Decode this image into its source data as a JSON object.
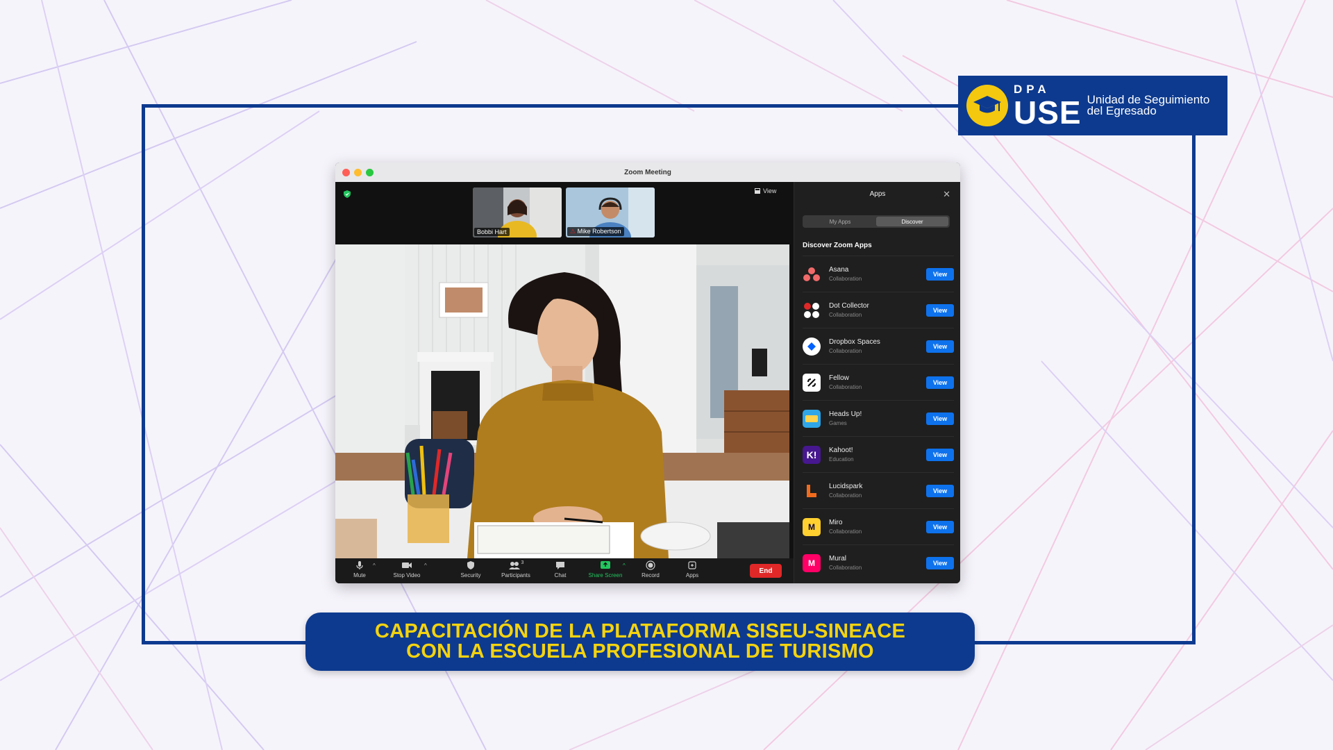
{
  "logo": {
    "dpa": "DPA",
    "use": "USE",
    "line1": "Unidad de Seguimiento",
    "line2": "del Egresado"
  },
  "window": {
    "title": "Zoom Meeting"
  },
  "meeting": {
    "view_label": "View",
    "participants": [
      {
        "name": "Bobbi Hart"
      },
      {
        "name": "Mike Robertson"
      }
    ]
  },
  "toolbar": {
    "mute": "Mute",
    "stop_video": "Stop Video",
    "security": "Security",
    "participants": "Participants",
    "participants_count": "3",
    "chat": "Chat",
    "share_screen": "Share Screen",
    "record": "Record",
    "apps": "Apps",
    "end": "End"
  },
  "apps_panel": {
    "title": "Apps",
    "tabs": [
      "My Apps",
      "Discover"
    ],
    "active_tab": "Discover",
    "heading": "Discover Zoom Apps",
    "view_label": "View",
    "items": [
      {
        "name": "Asana",
        "category": "Collaboration",
        "icon": "asana-icon"
      },
      {
        "name": "Dot Collector",
        "category": "Collaboration",
        "icon": "dot-collector-icon"
      },
      {
        "name": "Dropbox Spaces",
        "category": "Collaboration",
        "icon": "dropbox-icon"
      },
      {
        "name": "Fellow",
        "category": "Collaboration",
        "icon": "fellow-icon"
      },
      {
        "name": "Heads Up!",
        "category": "Games",
        "icon": "heads-up-icon"
      },
      {
        "name": "Kahoot!",
        "category": "Education",
        "icon": "kahoot-icon"
      },
      {
        "name": "Lucidspark",
        "category": "Collaboration",
        "icon": "lucidspark-icon"
      },
      {
        "name": "Miro",
        "category": "Collaboration",
        "icon": "miro-icon"
      },
      {
        "name": "Mural",
        "category": "Collaboration",
        "icon": "mural-icon"
      }
    ]
  },
  "banner": {
    "line1": "CAPACITACIÓN DE LA PLATAFORMA SISEU-SINEACE",
    "line2": "CON LA ESCUELA PROFESIONAL DE TURISMO"
  },
  "colors": {
    "frame": "#0d3a8f",
    "banner_text": "#f4d30f",
    "logo_circle": "#f4c80e",
    "view_button": "#0e72ed",
    "end_button": "#e02828"
  }
}
